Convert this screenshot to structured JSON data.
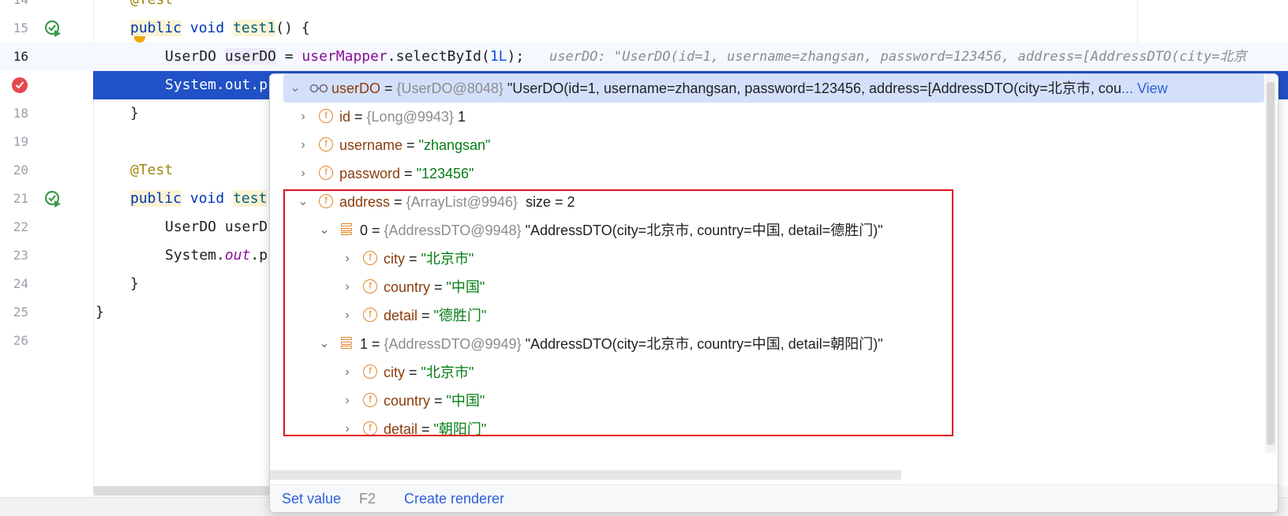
{
  "editor": {
    "lines": [
      {
        "num": "14",
        "text": "@Test"
      },
      {
        "num": "15",
        "text_parts": [
          "public",
          " ",
          "void",
          " ",
          "test1",
          "() {"
        ]
      },
      {
        "num": "16",
        "text_parts": [
          "UserDO",
          " ",
          "userDO",
          " = ",
          "userMapper",
          ".selectById(",
          "1L",
          ");"
        ]
      },
      {
        "num": "17",
        "text": "System.out.p"
      },
      {
        "num": "18",
        "text": "}"
      },
      {
        "num": "19",
        "text": ""
      },
      {
        "num": "20",
        "text": "@Test"
      },
      {
        "num": "21",
        "text_parts": [
          "public",
          " ",
          "void",
          " ",
          "test"
        ]
      },
      {
        "num": "22",
        "text": "UserDO userD"
      },
      {
        "num": "23",
        "text_parts": [
          "System.",
          "out",
          ".p"
        ]
      },
      {
        "num": "24",
        "text": "}"
      },
      {
        "num": "25",
        "text": "}"
      },
      {
        "num": "26",
        "text": ""
      }
    ],
    "inline_hint": "userDO: \"UserDO(id=1, username=zhangsan, password=123456, address=[AddressDTO(city=北京"
  },
  "debugger": {
    "root": {
      "name": "userDO",
      "type": "{UserDO@8048}",
      "value": "\"UserDO(id=1, username=zhangsan, password=123456, address=[AddressDTO(city=北京市, cou",
      "view_link": "... View"
    },
    "fields": [
      {
        "name": "id",
        "type": "{Long@9943}",
        "value": "1"
      },
      {
        "name": "username",
        "value": "\"zhangsan\""
      },
      {
        "name": "password",
        "value": "\"123456\""
      }
    ],
    "address": {
      "name": "address",
      "type": "{ArrayList@9946}",
      "size": "size = 2",
      "items": [
        {
          "index": "0",
          "type": "{AddressDTO@9948}",
          "summary": "\"AddressDTO(city=北京市, country=中国, detail=德胜门)\"",
          "fields": [
            {
              "name": "city",
              "value": "\"北京市\""
            },
            {
              "name": "country",
              "value": "\"中国\""
            },
            {
              "name": "detail",
              "value": "\"德胜门\""
            }
          ]
        },
        {
          "index": "1",
          "type": "{AddressDTO@9949}",
          "summary": "\"AddressDTO(city=北京市, country=中国, detail=朝阳门)\"",
          "fields": [
            {
              "name": "city",
              "value": "\"北京市\""
            },
            {
              "name": "country",
              "value": "\"中国\""
            },
            {
              "name": "detail",
              "value": "\"朝阳门\""
            }
          ]
        }
      ]
    },
    "footer": {
      "set_value": "Set value",
      "set_value_key": "F2",
      "create_renderer": "Create renderer"
    }
  },
  "symbols": {
    "eq": " = ",
    "field_icon": "f",
    "chev_right": "›",
    "chev_down": "⌄"
  },
  "colors": {
    "selection": "#2151c6",
    "highlight_box": "#e0101c",
    "link": "#2d5fd6"
  }
}
